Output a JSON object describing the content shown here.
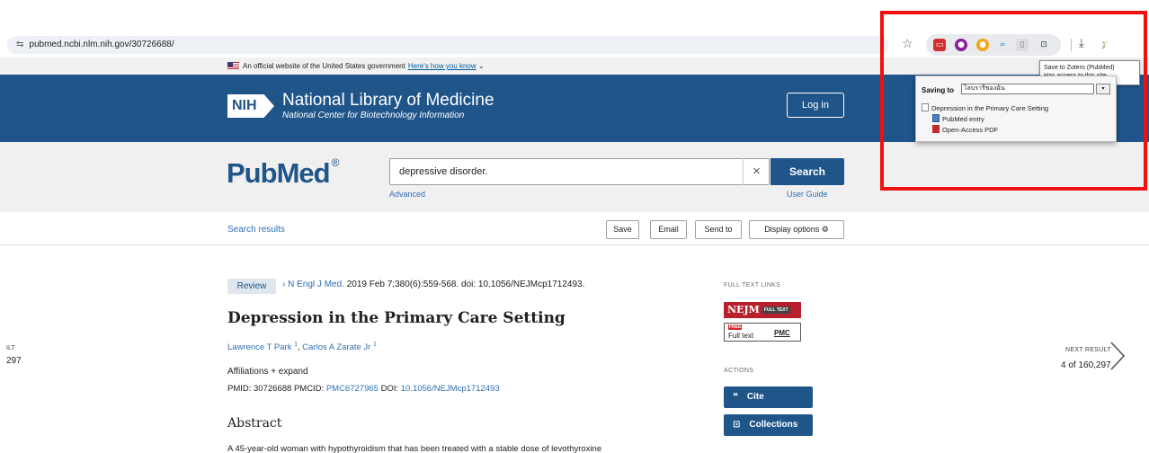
{
  "browser": {
    "url": "pubmed.ncbi.nlm.nih.gov/30726688/",
    "tune_icon": "⇆",
    "star_icon": "☆",
    "download_icon": "⤓",
    "zotero_icon": "𝓏"
  },
  "gov_banner": {
    "text": "An official website of the United States government",
    "link": "Here's how you know"
  },
  "nlm": {
    "badge": "NIH",
    "title": "National Library of Medicine",
    "subtitle": "National Center for Biotechnology Information",
    "login": "Log in"
  },
  "search": {
    "logo_pub": "Pub",
    "logo_med": "Med",
    "logo_reg": "®",
    "query": "depressive disorder.",
    "clear": "×",
    "button": "Search",
    "advanced": "Advanced",
    "user_guide": "User Guide"
  },
  "toolbar": {
    "search_results": "Search results",
    "save": "Save",
    "email": "Email",
    "send_to": "Send to",
    "display_options": "Display options",
    "gear": "⚙"
  },
  "article": {
    "review": "Review",
    "chev": "›",
    "journal": "N Engl J Med.",
    "citation": " 2019 Feb 7;380(6):559-568. doi: 10.1056/NEJMcp1712493.",
    "title": "Depression in the Primary Care Setting",
    "author1": "Lawrence T Park",
    "author1_sup": "1",
    "author_sep": ", ",
    "author2": "Carlos A Zarate Jr",
    "author2_sup": "1",
    "affiliations": "Affiliations",
    "expand": "+ expand",
    "pmid_label": "PMID: 30726688",
    "pmcid_label": "PMCID:",
    "pmcid": "PMC6727965",
    "doi_label": "DOI:",
    "doi": "10.1056/NEJMcp1712493",
    "abstract_heading": "Abstract",
    "abstract_text": "A 45-year-old woman with hypothyroidism that has been treated with a stable dose of levothyroxine"
  },
  "right_col": {
    "full_text_links": "FULL TEXT LINKS",
    "nejm": "NEJM",
    "nejm_ft": "FULL TEXT",
    "pmc_free": "FREE",
    "pmc_full": "Full text",
    "pmc_logo": "PMC",
    "actions": "ACTIONS",
    "cite_icon": "❝",
    "cite": "Cite",
    "collections_icon": "⊡",
    "collections": "Collections"
  },
  "nav": {
    "prev_label": "ILT",
    "prev_num": "297",
    "next_label": "NEXT RESULT",
    "next_num": "4 of 160,297"
  },
  "zotero": {
    "tooltip_line1": "Save to Zotero (PubMed)",
    "tooltip_line2": "Has access to this site",
    "saving_to": "Saving to",
    "library": "ไลบรารีของฉัน",
    "dropdown_arrow": "▾",
    "item_title": "Depression in the Primary Care Setting",
    "attach1": "PubMed entry",
    "attach2": "Open-Access PDF"
  },
  "colors": {
    "nlm_blue": "#20558a",
    "link_blue": "#2f6fb0",
    "highlight_red": "#ee1111"
  }
}
